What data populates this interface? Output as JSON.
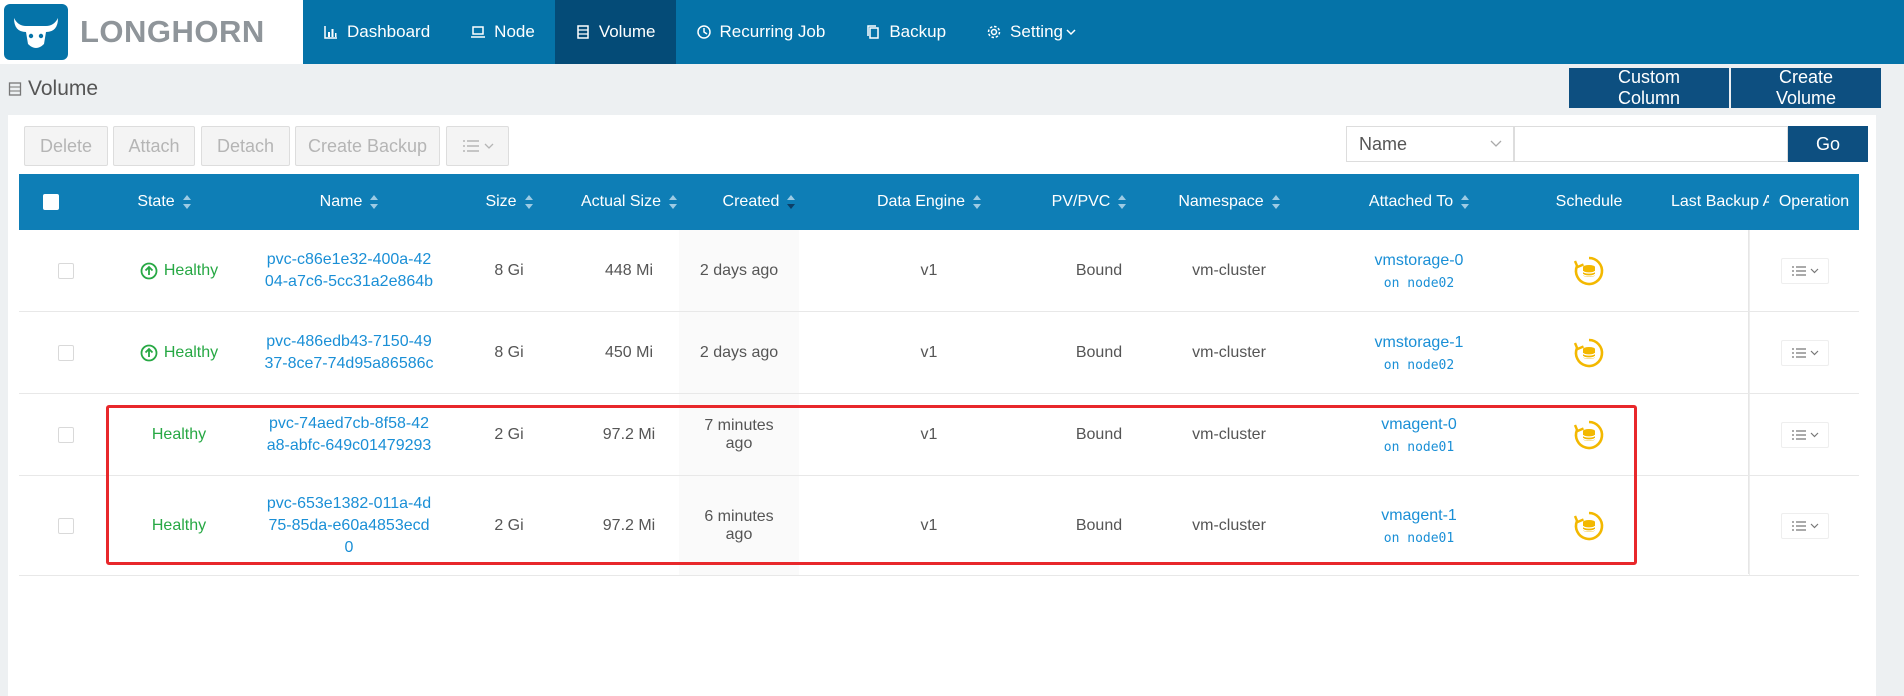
{
  "app": {
    "brand": "LONGHORN"
  },
  "nav": [
    {
      "label": "Dashboard",
      "icon": "bar-chart-icon"
    },
    {
      "label": "Node",
      "icon": "laptop-icon"
    },
    {
      "label": "Volume",
      "icon": "database-icon"
    },
    {
      "label": "Recurring Job",
      "icon": "clock-icon"
    },
    {
      "label": "Backup",
      "icon": "copy-icon"
    },
    {
      "label": "Setting",
      "icon": "gear-icon"
    }
  ],
  "page": {
    "title": "Volume",
    "custom_column": "Custom Column",
    "create_volume": "Create Volume"
  },
  "toolbar": {
    "delete": "Delete",
    "attach": "Attach",
    "detach": "Detach",
    "create_backup": "Create Backup"
  },
  "filter": {
    "field": "Name",
    "go": "Go"
  },
  "columns": [
    "State",
    "Name",
    "Size",
    "Actual Size",
    "Created",
    "Data Engine",
    "PV/PVC",
    "Namespace",
    "Attached To",
    "Schedule",
    "Last Backup A",
    "Operation"
  ],
  "rows": [
    {
      "state": "Healthy",
      "name_l1": "pvc-c86e1e32-400a-42",
      "name_l2": "04-a7c6-5cc31a2e864b",
      "name_l3": "",
      "size": "8 Gi",
      "actual": "448 Mi",
      "created_l1": "2 days ago",
      "created_l2": "",
      "engine": "v1",
      "pvc": "Bound",
      "ns": "vm-cluster",
      "attached": "vmstorage-0",
      "node": "on node02"
    },
    {
      "state": "Healthy",
      "name_l1": "pvc-486edb43-7150-49",
      "name_l2": "37-8ce7-74d95a86586c",
      "name_l3": "",
      "size": "8 Gi",
      "actual": "450 Mi",
      "created_l1": "2 days ago",
      "created_l2": "",
      "engine": "v1",
      "pvc": "Bound",
      "ns": "vm-cluster",
      "attached": "vmstorage-1",
      "node": "on node02"
    },
    {
      "state": "Healthy",
      "name_l1": "pvc-74aed7cb-8f58-42",
      "name_l2": "a8-abfc-649c01479293",
      "name_l3": "",
      "size": "2 Gi",
      "actual": "97.2 Mi",
      "created_l1": "7 minutes",
      "created_l2": "ago",
      "engine": "v1",
      "pvc": "Bound",
      "ns": "vm-cluster",
      "attached": "vmagent-0",
      "node": "on node01"
    },
    {
      "state": "Healthy",
      "name_l1": "pvc-653e1382-011a-4d",
      "name_l2": "75-85da-e60a4853ecd",
      "name_l3": "0",
      "size": "2 Gi",
      "actual": "97.2 Mi",
      "created_l1": "6 minutes",
      "created_l2": "ago",
      "engine": "v1",
      "pvc": "Bound",
      "ns": "vm-cluster",
      "attached": "vmagent-1",
      "node": "on node01"
    }
  ],
  "colors": {
    "nav": "#0573a8",
    "nav_active": "#044b77",
    "table_header": "#0e7eb6",
    "healthy": "#27a844",
    "link": "#1a8fd6",
    "schedule": "#f3b800",
    "highlight": "#e8282b"
  }
}
